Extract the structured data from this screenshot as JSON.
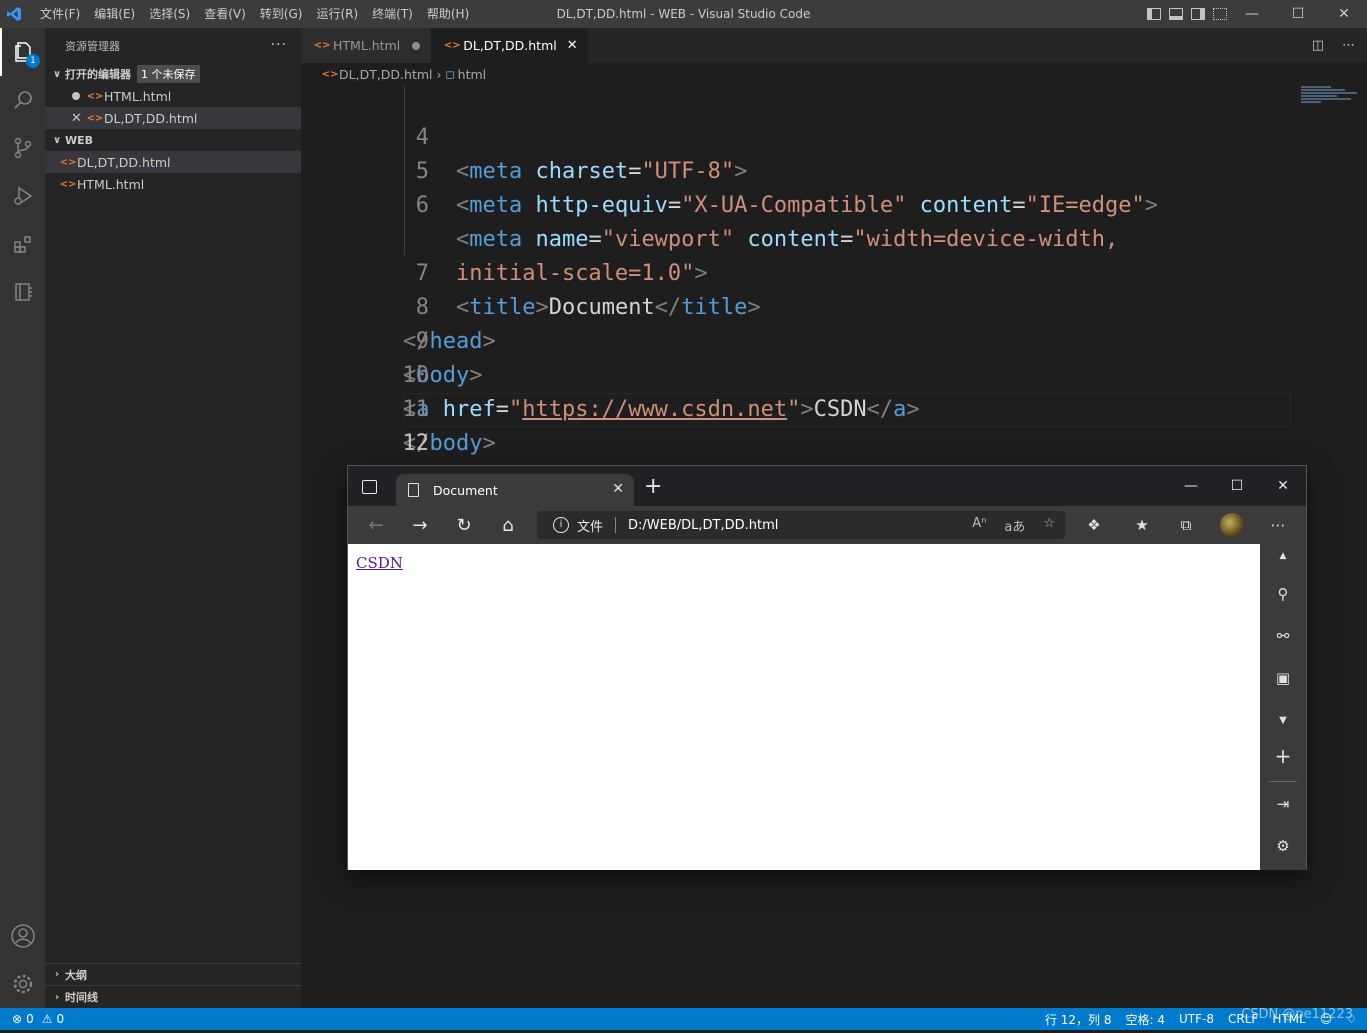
{
  "titlebar": {
    "menu": [
      "文件(F)",
      "编辑(E)",
      "选择(S)",
      "查看(V)",
      "转到(G)",
      "运行(R)",
      "终端(T)",
      "帮助(H)"
    ],
    "title": "DL,DT,DD.html - WEB - Visual Studio Code"
  },
  "activitybar": {
    "explorer_badge": "1"
  },
  "sidebar": {
    "header": "资源管理器",
    "more": "···",
    "open_editors_title": "打开的编辑器",
    "open_editors_badge": "1 个未保存",
    "open_editors": [
      {
        "name": "HTML.html",
        "state": "modified"
      },
      {
        "name": "DL,DT,DD.html",
        "state": "active"
      }
    ],
    "folder_title": "WEB",
    "files": [
      "DL,DT,DD.html",
      "HTML.html"
    ],
    "outline_title": "大纲",
    "timeline_title": "时间线"
  },
  "tabs": [
    {
      "label": "HTML.html",
      "modified": true,
      "active": false
    },
    {
      "label": "DL,DT,DD.html",
      "modified": false,
      "active": true
    }
  ],
  "breadcrumb": {
    "file": "DL,DT,DD.html",
    "symbol": "html"
  },
  "code": {
    "current_line": 12,
    "lines": [
      {
        "num": "4"
      },
      {
        "num": "5"
      },
      {
        "num": "6"
      },
      {
        "num": ""
      },
      {
        "num": "7"
      },
      {
        "num": "8"
      },
      {
        "num": "9"
      },
      {
        "num": "10"
      },
      {
        "num": "11"
      },
      {
        "num": "12"
      }
    ],
    "tokens": {
      "meta": "meta",
      "charset": "charset",
      "utf8": "\"UTF-8\"",
      "http_equiv": "http-equiv",
      "x_ua": "\"X-UA-Compatible\"",
      "content": "content",
      "ie_edge": "\"IE=edge\"",
      "name": "name",
      "viewport": "\"viewport\"",
      "width_device": "\"width=device-width,",
      "initial_scale": "initial-scale=1.0\"",
      "title": "title",
      "document": "Document",
      "head": "head",
      "body": "body",
      "a": "a",
      "href": "href",
      "url": "https://www.csdn.net",
      "quote": "\"",
      "csdn": "CSDN",
      "html": "html"
    }
  },
  "browser": {
    "tab_title": "Document",
    "address_label": "文件",
    "address": "D:/WEB/DL,DT,DD.html",
    "page_link": "CSDN"
  },
  "statusbar": {
    "errors": "0",
    "warnings": "0",
    "position": "行 12，列 8",
    "spaces": "空格: 4",
    "encoding": "UTF-8",
    "eol": "CRLF",
    "language": "HTML"
  },
  "watermark": "CSDN @pe11223",
  "colors": {
    "accent": "#007acc",
    "tag": "#569cd6",
    "attribute": "#9cdcfe",
    "string": "#ce9178",
    "html_icon": "#e37933"
  }
}
